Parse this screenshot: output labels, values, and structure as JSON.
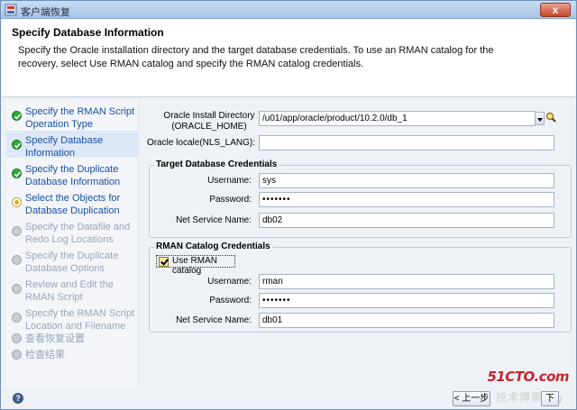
{
  "window": {
    "title": "客户端恢复",
    "close_label": "x"
  },
  "header": {
    "title": "Specify Database Information",
    "description": "Specify the Oracle installation directory and the target database credentials.  To use an RMAN catalog for the recovery, select Use RMAN catalog and specify the RMAN catalog credentials."
  },
  "steps": [
    {
      "label": "Specify the RMAN Script Operation Type",
      "state": "done"
    },
    {
      "label": "Specify Database Information",
      "state": "done"
    },
    {
      "label": "Specify the Duplicate Database Information",
      "state": "done"
    },
    {
      "label": "Select the Objects for Database Duplication",
      "state": "current"
    },
    {
      "label": "Specify the Datafile and Redo Log Locations",
      "state": "pending"
    },
    {
      "label": "Specify the Duplicate Database Options",
      "state": "pending"
    },
    {
      "label": "Review and Edit the RMAN Script",
      "state": "pending"
    },
    {
      "label": "Specify the RMAN Script Location and Filename",
      "state": "pending"
    },
    {
      "label": "查看恢复设置",
      "state": "pending"
    },
    {
      "label": "检查结果",
      "state": "pending"
    }
  ],
  "oracle": {
    "install_dir_label": "Oracle Install Directory (ORACLE_HOME)",
    "install_dir_value": "/u01/app/oracle/product/10.2.0/db_1",
    "locale_label": "Oracle locale(NLS_LANG):",
    "locale_value": ""
  },
  "target": {
    "group_title": "Target Database Credentials",
    "username_label": "Username:",
    "username_value": "sys",
    "password_label": "Password:",
    "password_value": "•••••••",
    "service_label": "Net Service Name:",
    "service_value": "db02"
  },
  "rman": {
    "group_title": "RMAN Catalog Credentials",
    "use_catalog_label": "Use RMAN catalog",
    "use_catalog_checked": true,
    "username_label": "Username:",
    "username_value": "rman",
    "password_label": "Password:",
    "password_value": "•••••••",
    "service_label": "Net Service Name:",
    "service_value": "db01"
  },
  "footer": {
    "help_label": "?",
    "back_label": "< 上一步",
    "next_label": "下"
  },
  "watermark": {
    "main": "51CTO.com",
    "sub": "技术博客",
    "blog": "Blog"
  }
}
